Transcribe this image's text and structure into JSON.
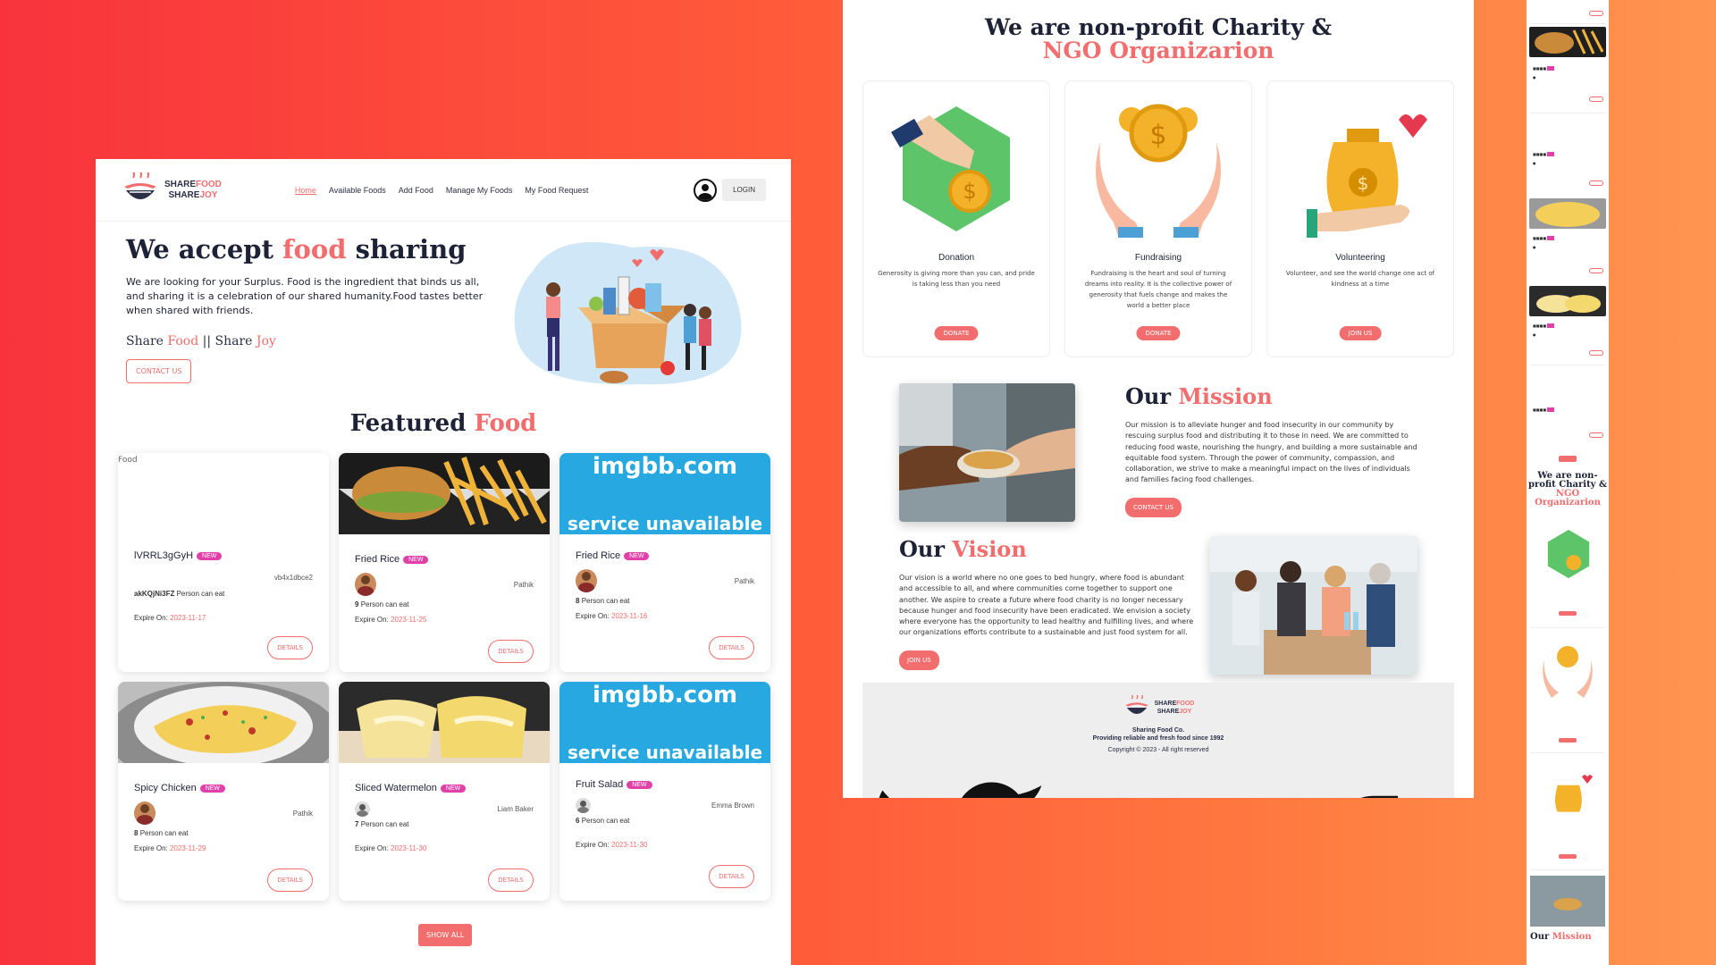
{
  "brand": {
    "share_food": "SHAREFOOD",
    "share_joy": "SHAREJOY"
  },
  "nav": {
    "links": [
      "Home",
      "Available Foods",
      "Add Food",
      "Manage My Foods",
      "My Food Request"
    ],
    "login": "LOGIN"
  },
  "hero": {
    "title_pre": "We accept ",
    "title_acc": "food",
    "title_post": " sharing",
    "text": "We are looking for your Surplus. Food is the ingredient that binds us all, and sharing it is a celebration of our shared humanity.Food tastes better when shared with friends.",
    "tag_1": "Share ",
    "tag_2": "Food",
    "tag_3": " || Share ",
    "tag_4": "Joy",
    "contact": "CONTACT US"
  },
  "featured": {
    "title_pre": "Featured ",
    "title_acc": "Food",
    "badge": "NEW",
    "qty_suffix": "Person can eat",
    "expire_label": "Expire On: ",
    "details": "DETAILS",
    "show_all": "SHOW ALL",
    "broken_alt": "Food",
    "imgbb_1": "imgbb.com",
    "imgbb_2": "service unavailable",
    "cards": [
      {
        "name": "lVRRL3gGyH",
        "donor": "vb4x1dbce2",
        "qty": "akKQjNi3FZ",
        "expire": "2023-11-17"
      },
      {
        "name": "Fried Rice",
        "donor": "Pathik",
        "qty": "9",
        "expire": "2023-11-25"
      },
      {
        "name": "Fried Rice",
        "donor": "Pathik",
        "qty": "8",
        "expire": "2023-11-16"
      },
      {
        "name": "Spicy Chicken",
        "donor": "Pathik",
        "qty": "8",
        "expire": "2023-11-29"
      },
      {
        "name": "Sliced Watermelon",
        "donor": "Liam Baker",
        "qty": "7",
        "expire": "2023-11-30"
      },
      {
        "name": "Fruit Salad",
        "donor": "Emma Brown",
        "qty": "6",
        "expire": "2023-11-30"
      }
    ]
  },
  "np": {
    "title_1": "We are non-profit Charity &",
    "title_2": "NGO Organizarion",
    "services": [
      {
        "title": "Donation",
        "text": "Generosity is giving more than you can, and pride is taking less than you need",
        "btn": "DONATE"
      },
      {
        "title": "Fundraising",
        "text": "Fundraising is the heart and soul of turning dreams into reality. It is the collective power of generosity that fuels change and makes the world a better place",
        "btn": "DONATE"
      },
      {
        "title": "Volunteering",
        "text": "Volunteer, and see the world change one act of kindness at a time",
        "btn": "JOIN US"
      }
    ]
  },
  "mission": {
    "h_pre": "Our ",
    "h_acc": "Mission",
    "text": "Our mission is to alleviate hunger and food insecurity in our community by rescuing surplus food and distributing it to those in need. We are committed to reducing food waste, nourishing the hungry, and building a more sustainable and equitable food system. Through the power of community, compassion, and collaboration, we strive to make a meaningful impact on the lives of individuals and families facing food challenges.",
    "btn": "CONTACT US"
  },
  "vision": {
    "h_pre": "Our ",
    "h_acc": "Vision",
    "text": "Our vision is a world where no one goes to bed hungry, where food is abundant and accessible to all, and where communities come together to support one another. We aspire to create a future where food charity is no longer necessary because hunger and food insecurity have been eradicated. We envision a society where everyone has the opportunity to lead healthy and fulfilling lives, and where our organizations efforts contribute to a sustainable and just food system for all.",
    "btn": "JOIN US"
  },
  "footer": {
    "name": "Sharing Food Co.",
    "tagline": "Providing reliable and fresh food since 1992",
    "copyright": "Copyright © 2023 - All right reserved",
    "icons": [
      "twitter-icon",
      "youtube-icon",
      "facebook-icon"
    ]
  },
  "mobile": {
    "title_1": "We are non-",
    "title_2": "profit Charity &",
    "title_3": "NGO",
    "title_4": "Organizarion",
    "mission_pre": "Our ",
    "mission_acc": "Mission"
  },
  "colors": {
    "accent": "#f26d6d",
    "badge": "#e040a8",
    "dark": "#1d2236",
    "imgbb": "#27a8e0"
  }
}
